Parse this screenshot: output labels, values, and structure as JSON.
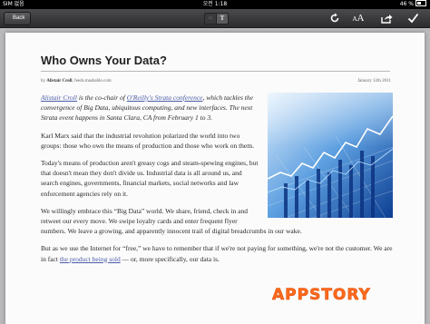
{
  "status_bar": {
    "carrier": "SIM 없음",
    "time": "오전 1:18",
    "battery": "46 %"
  },
  "toolbar": {
    "back_label": "Back",
    "mode_web": "▭",
    "mode_text": "T",
    "refresh_icon": "refresh-icon",
    "font_size_label": "AA",
    "share_icon": "share-icon",
    "done_icon": "checkmark-icon"
  },
  "article": {
    "title": "Who Owns Your Data?",
    "by_prefix": "by ",
    "author": "Alistair Croll",
    "source": ", feeds.mashable.com",
    "date": "January 12th 2011",
    "intro": {
      "link1": "Alistair Croll",
      "text1": " is the co-chair of ",
      "link2": "O'Reilly's Strata conference",
      "text2": ", which tackles the convergence of Big Data, ubiquitous computing, and new interfaces. The next Strata event happens in Santa Clara, CA from February 1 to 3."
    },
    "p1": "Karl Marx said that the industrial revolution polarized the world into two groups: those who own the means of production and those who work on them.",
    "p2": "Today's means of production aren't greasy cogs and steam-spewing engines, but that doesn't mean they don't divide us. Industrial data is all around us, and search engines, governments, financial markets, social networks and law enforcement agencies rely on it.",
    "p3": "We willingly embrace this “Big Data” world. We share, friend, check in and retweet our every move. We swipe loyalty cards and enter frequent flyer numbers. We leave a growing, and apparently innocent trail of digital breadcrumbs in our wake.",
    "p4_a": "But as we use the Internet for “free,” we have to remember that if we're not paying for something, we're not the customer. We are in fact ",
    "p4_link": "the product being sold",
    "p4_b": " — or, more specifically, our data is."
  },
  "watermark": "APPSTORY",
  "colors": {
    "link": "#4a5ba8",
    "watermark": "#ff6a1f",
    "toolbar": "#3a3a3c"
  }
}
